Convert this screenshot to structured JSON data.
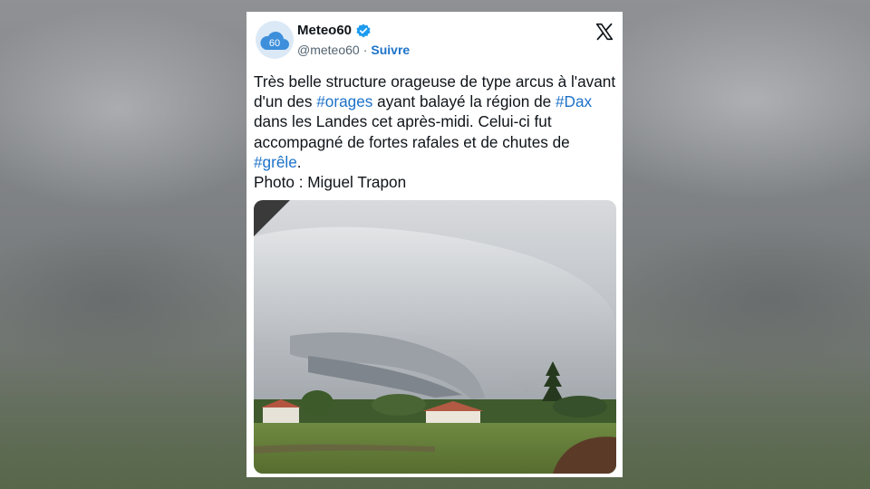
{
  "account": {
    "name": "Meteo60",
    "handle": "@meteo60",
    "separator": "·",
    "follow_label": "Suivre",
    "avatar_text": "60"
  },
  "tweet": {
    "part1": "Très belle structure orageuse de type arcus à l'avant d'un des ",
    "tag1": "#orages",
    "part2": " ayant balayé la région de ",
    "tag2": "#Dax",
    "part3": " dans les Landes cet après-midi. Celui-ci fut accompagné de fortes rafales et de chutes de ",
    "tag3": "#grêle",
    "part4": ".",
    "credit": "Photo : Miguel Trapon"
  },
  "colors": {
    "link": "#1d72c9",
    "verified": "#1d9bf0"
  },
  "icons": [
    "cloud-avatar-icon",
    "verified-badge-icon",
    "x-logo-icon"
  ]
}
